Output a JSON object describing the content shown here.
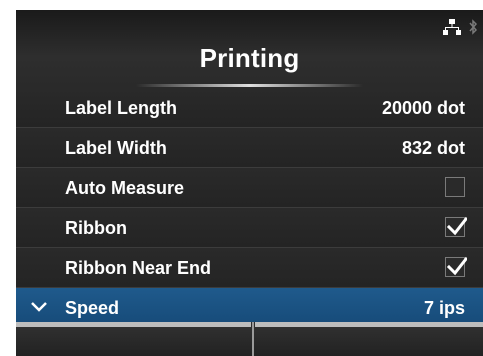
{
  "header": {
    "title": "Printing",
    "status_icons": [
      "network-icon",
      "bluetooth-icon"
    ]
  },
  "items": [
    {
      "label": "Label Length",
      "value": "20000 dot",
      "type": "value"
    },
    {
      "label": "Label Width",
      "value": "832 dot",
      "type": "value"
    },
    {
      "label": "Auto Measure",
      "checked": false,
      "type": "checkbox"
    },
    {
      "label": "Ribbon",
      "checked": true,
      "type": "checkbox"
    },
    {
      "label": "Ribbon Near End",
      "checked": true,
      "type": "checkbox"
    },
    {
      "label": "Speed",
      "value": "7 ips",
      "type": "value",
      "selected": true,
      "icon": "chevron-down-icon"
    }
  ],
  "colors": {
    "background": "#262626",
    "selected": "#1a5284",
    "text": "#ffffff"
  }
}
